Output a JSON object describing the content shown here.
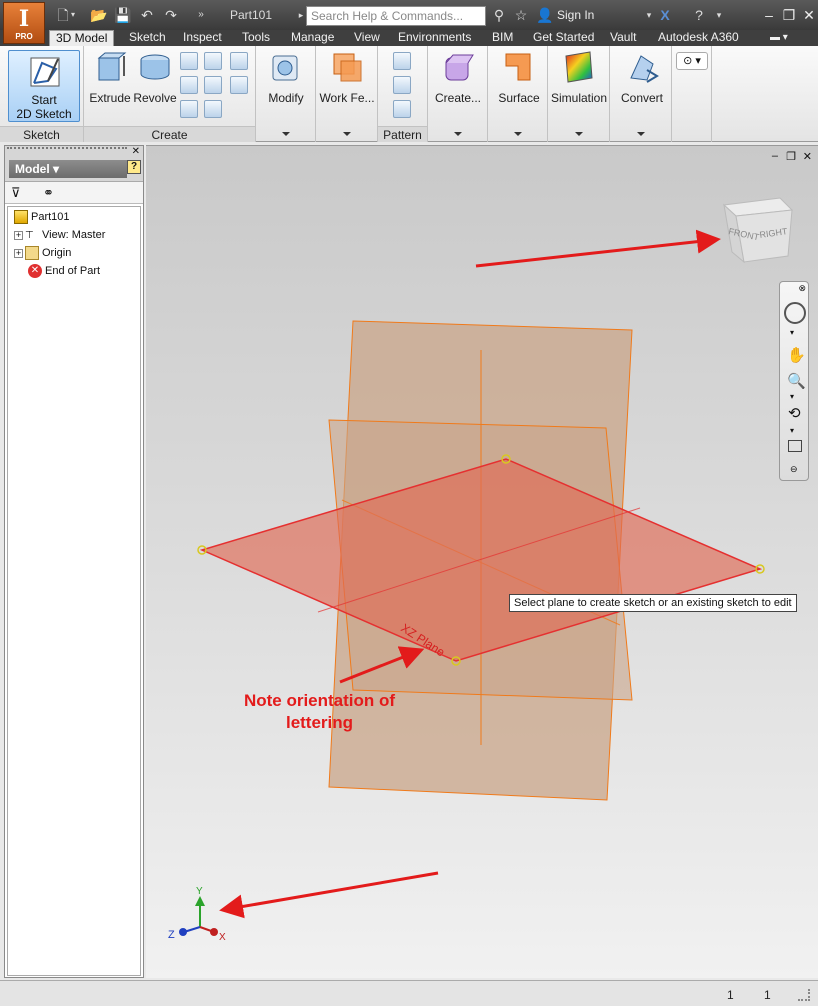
{
  "window": {
    "document_title": "Part101",
    "search_placeholder": "Search Help & Commands...",
    "sign_in": "Sign In",
    "app_badge": "PRO"
  },
  "ribbon_tabs": [
    "3D Model",
    "Sketch",
    "Inspect",
    "Tools",
    "Manage",
    "View",
    "Environments",
    "BIM",
    "Get Started",
    "Vault",
    "Autodesk A360"
  ],
  "ribbon": {
    "sketch_panel": {
      "start_line1": "Start",
      "start_line2": "2D Sketch",
      "label": "Sketch"
    },
    "create_panel": {
      "extrude": "Extrude",
      "revolve": "Revolve",
      "label": "Create"
    },
    "modify": "Modify",
    "work_features": "Work Fe...",
    "pattern": "Pattern",
    "create_freeform": "Create...",
    "surface": "Surface",
    "simulation": "Simulation",
    "convert": "Convert"
  },
  "browser": {
    "title": "Model",
    "tree": [
      {
        "label": "Part101",
        "icon": "part-icon"
      },
      {
        "label": "View: Master",
        "icon": "view-icon"
      },
      {
        "label": "Origin",
        "icon": "folder-icon"
      },
      {
        "label": "End of Part",
        "icon": "end-of-part-icon"
      }
    ]
  },
  "viewport": {
    "tooltip": "Select plane to create sketch or an existing sketch to edit",
    "plane_label": "XZ Plane",
    "annotation_line1": "Note orientation of",
    "annotation_line2": "lettering",
    "viewcube": {
      "front": "FRONT",
      "right": "RIGHT"
    },
    "axes": {
      "x": "X",
      "y": "Y",
      "z": "Z"
    }
  },
  "status": {
    "value1": "1",
    "value2": "1"
  },
  "colors": {
    "plane_fill": "#e06a55",
    "plane_stroke": "#e53030",
    "work_plane": "#c9a58a",
    "work_plane_stroke": "#f07a1a",
    "annotation": "#e31b1b",
    "ribbon_tab_active": "#ececec"
  }
}
